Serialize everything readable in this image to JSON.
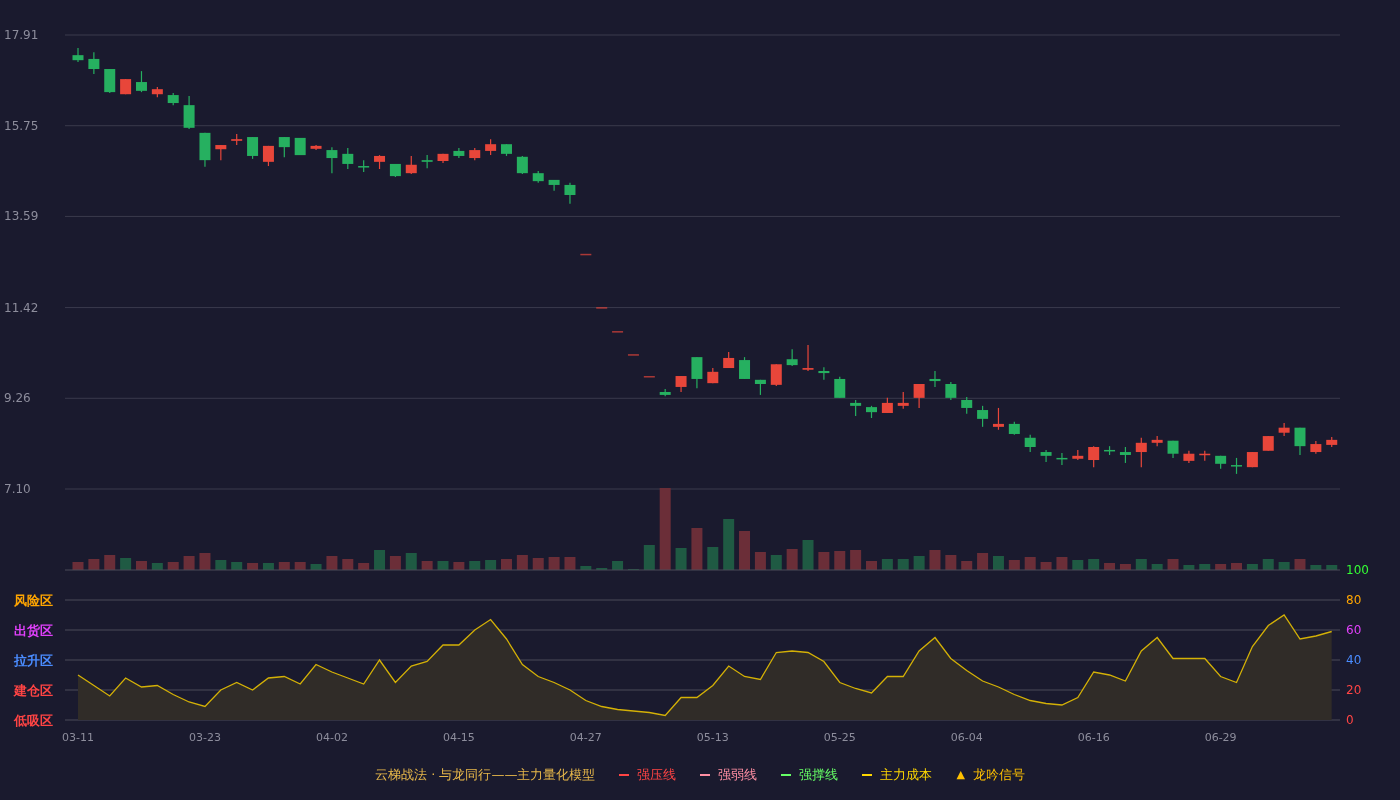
{
  "price_chart": {
    "chart_data": {
      "type": "candlestick",
      "grid": true,
      "ylim": [
        7.1,
        17.91
      ],
      "yticks": [
        {
          "value": 17.91,
          "label": "17.91"
        },
        {
          "value": 15.75,
          "label": "15.75"
        },
        {
          "value": 13.59,
          "label": "13.59"
        },
        {
          "value": 11.42,
          "label": "11.42"
        },
        {
          "value": 9.26,
          "label": "9.26"
        },
        {
          "value": 7.1,
          "label": "7.10"
        }
      ],
      "ohlc": [
        [
          17.43,
          17.6,
          17.27,
          17.31
        ],
        [
          17.34,
          17.5,
          16.98,
          17.1
        ],
        [
          17.1,
          17.1,
          16.53,
          16.55
        ],
        [
          16.5,
          16.86,
          16.5,
          16.86
        ],
        [
          16.79,
          17.05,
          16.55,
          16.58
        ],
        [
          16.5,
          16.67,
          16.43,
          16.62
        ],
        [
          16.48,
          16.53,
          16.24,
          16.29
        ],
        [
          16.24,
          16.46,
          15.67,
          15.7
        ],
        [
          15.58,
          15.58,
          14.77,
          14.93
        ],
        [
          15.19,
          15.29,
          14.93,
          15.29
        ],
        [
          15.39,
          15.55,
          15.29,
          15.43
        ],
        [
          15.48,
          15.48,
          14.96,
          15.03
        ],
        [
          14.89,
          15.27,
          14.79,
          15.27
        ],
        [
          15.48,
          15.48,
          15.0,
          15.24
        ],
        [
          15.46,
          15.46,
          15.05,
          15.05
        ],
        [
          15.2,
          15.29,
          15.17,
          15.27
        ],
        [
          15.17,
          15.24,
          14.62,
          14.98
        ],
        [
          15.08,
          15.22,
          14.72,
          14.84
        ],
        [
          14.79,
          14.93,
          14.65,
          14.76
        ],
        [
          14.89,
          15.05,
          14.72,
          15.03
        ],
        [
          14.84,
          14.84,
          14.53,
          14.55
        ],
        [
          14.62,
          15.03,
          14.6,
          14.82
        ],
        [
          14.93,
          15.05,
          14.74,
          14.89
        ],
        [
          14.91,
          15.08,
          14.86,
          15.08
        ],
        [
          15.15,
          15.22,
          14.98,
          15.03
        ],
        [
          14.98,
          15.22,
          14.93,
          15.17
        ],
        [
          15.15,
          15.43,
          15.05,
          15.31
        ],
        [
          15.31,
          15.31,
          15.03,
          15.08
        ],
        [
          15.01,
          15.03,
          14.6,
          14.62
        ],
        [
          14.62,
          14.67,
          14.39,
          14.43
        ],
        [
          14.46,
          14.46,
          14.2,
          14.34
        ],
        [
          14.34,
          14.39,
          13.89,
          14.1
        ],
        [
          12.7,
          12.7,
          12.7,
          12.7
        ],
        [
          11.43,
          11.43,
          11.43,
          11.43
        ],
        [
          10.86,
          10.86,
          10.86,
          10.86
        ],
        [
          10.31,
          10.31,
          10.31,
          10.31
        ],
        [
          9.79,
          9.79,
          9.79,
          9.79
        ],
        [
          9.41,
          9.48,
          9.31,
          9.34
        ],
        [
          9.53,
          9.79,
          9.41,
          9.79
        ],
        [
          10.24,
          10.24,
          9.5,
          9.72
        ],
        [
          9.62,
          9.98,
          9.62,
          9.89
        ],
        [
          9.98,
          10.36,
          9.98,
          10.22
        ],
        [
          10.17,
          10.24,
          9.72,
          9.72
        ],
        [
          9.7,
          9.7,
          9.34,
          9.6
        ],
        [
          9.58,
          10.07,
          9.55,
          10.07
        ],
        [
          10.19,
          10.43,
          10.03,
          10.05
        ],
        [
          9.94,
          10.53,
          9.91,
          9.98
        ],
        [
          9.91,
          10.0,
          9.7,
          9.86
        ],
        [
          9.72,
          9.77,
          9.27,
          9.27
        ],
        [
          9.15,
          9.22,
          8.84,
          9.08
        ],
        [
          9.05,
          9.08,
          8.79,
          8.93
        ],
        [
          8.91,
          9.27,
          8.91,
          9.15
        ],
        [
          9.08,
          9.41,
          9.01,
          9.15
        ],
        [
          9.27,
          9.6,
          9.03,
          9.6
        ],
        [
          9.72,
          9.91,
          9.53,
          9.67
        ],
        [
          9.6,
          9.65,
          9.22,
          9.27
        ],
        [
          9.22,
          9.29,
          8.89,
          9.03
        ],
        [
          8.98,
          9.08,
          8.58,
          8.77
        ],
        [
          8.58,
          9.03,
          8.51,
          8.65
        ],
        [
          8.65,
          8.7,
          8.39,
          8.41
        ],
        [
          8.32,
          8.39,
          7.98,
          8.1
        ],
        [
          7.98,
          8.03,
          7.74,
          7.89
        ],
        [
          7.84,
          7.96,
          7.67,
          7.82
        ],
        [
          7.82,
          8.03,
          7.79,
          7.89
        ],
        [
          7.79,
          8.12,
          7.62,
          8.1
        ],
        [
          8.03,
          8.12,
          7.91,
          8.01
        ],
        [
          7.98,
          8.1,
          7.72,
          7.91
        ],
        [
          7.98,
          8.32,
          7.62,
          8.2
        ],
        [
          8.2,
          8.36,
          8.12,
          8.27
        ],
        [
          8.25,
          8.25,
          7.84,
          7.94
        ],
        [
          7.77,
          8.01,
          7.72,
          7.94
        ],
        [
          7.91,
          8.01,
          7.77,
          7.94
        ],
        [
          7.89,
          7.89,
          7.58,
          7.7
        ],
        [
          7.67,
          7.84,
          7.46,
          7.65
        ],
        [
          7.62,
          7.98,
          7.62,
          7.98
        ],
        [
          8.01,
          8.36,
          8.01,
          8.36
        ],
        [
          8.44,
          8.67,
          8.36,
          8.56
        ],
        [
          8.56,
          8.56,
          7.91,
          8.12
        ],
        [
          7.98,
          8.24,
          7.94,
          8.17
        ],
        [
          8.15,
          8.34,
          8.1,
          8.27
        ]
      ]
    }
  },
  "oscillator": {
    "zones": [
      {
        "label": "风险区",
        "color": "#ffa500"
      },
      {
        "label": "出货区",
        "color": "#e040fb"
      },
      {
        "label": "拉升区",
        "color": "#4a8cff"
      },
      {
        "label": "建仓区",
        "color": "#ff4444"
      },
      {
        "label": "低吸区",
        "color": "#ff4444"
      }
    ],
    "axis_label_colors": [
      {
        "color": "#ff4444"
      },
      {
        "color": "#ff4444"
      },
      {
        "color": "#4a8cff"
      },
      {
        "color": "#e040fb"
      },
      {
        "color": "#ffa500"
      },
      {
        "color": "#33ff33"
      }
    ],
    "chart_data": {
      "type": "area",
      "grid": true,
      "ylim": [
        0,
        100
      ],
      "yticks": [
        0,
        20,
        40,
        60,
        80,
        100
      ],
      "categories": [
        "03-11",
        null,
        null,
        null,
        null,
        null,
        null,
        null,
        "03-23",
        null,
        null,
        null,
        null,
        null,
        null,
        null,
        "04-02",
        null,
        null,
        null,
        null,
        null,
        null,
        null,
        "04-15",
        null,
        null,
        null,
        null,
        null,
        null,
        null,
        "04-27",
        null,
        null,
        null,
        null,
        null,
        null,
        null,
        "05-13",
        null,
        null,
        null,
        null,
        null,
        null,
        null,
        "05-25",
        null,
        null,
        null,
        null,
        null,
        null,
        null,
        "06-04",
        null,
        null,
        null,
        null,
        null,
        null,
        null,
        "06-16",
        null,
        null,
        null,
        null,
        null,
        null,
        null,
        "06-29",
        null,
        null,
        null,
        null,
        null,
        null,
        null
      ],
      "series": [
        {
          "color": "#d4b106",
          "values": [
            30,
            23,
            16,
            28,
            22,
            23,
            17,
            12,
            9,
            20,
            25,
            20,
            28,
            29,
            24,
            37,
            32,
            28,
            24,
            40,
            25,
            36,
            39,
            50,
            50,
            60,
            67,
            54,
            37,
            29,
            25,
            20,
            13,
            9,
            7,
            6,
            5,
            3,
            15,
            15,
            23,
            36,
            29,
            27,
            45,
            46,
            45,
            39,
            25,
            21,
            18,
            29,
            29,
            46,
            55,
            41,
            33,
            26,
            22,
            17,
            13,
            11,
            10,
            15,
            32,
            30,
            26,
            46,
            55,
            41,
            41,
            41,
            29,
            25,
            49,
            63,
            70,
            54,
            56,
            59
          ]
        }
      ]
    }
  },
  "legend": {
    "title": "云梯战法 · 与龙同行——主力量化模型",
    "items": [
      {
        "kind": "solid",
        "label": "强压线",
        "color": "#ff4444"
      },
      {
        "kind": "dashed",
        "label": "强弱线",
        "color": "#ff8fa3"
      },
      {
        "kind": "solid",
        "label": "强撑线",
        "color": "#66ff66"
      },
      {
        "kind": "dashed",
        "label": "主力成本",
        "color": "#ffd700"
      },
      {
        "kind": "triangle",
        "symbol": "▲",
        "label": "龙吟信号",
        "color": "#ffc000"
      }
    ]
  }
}
